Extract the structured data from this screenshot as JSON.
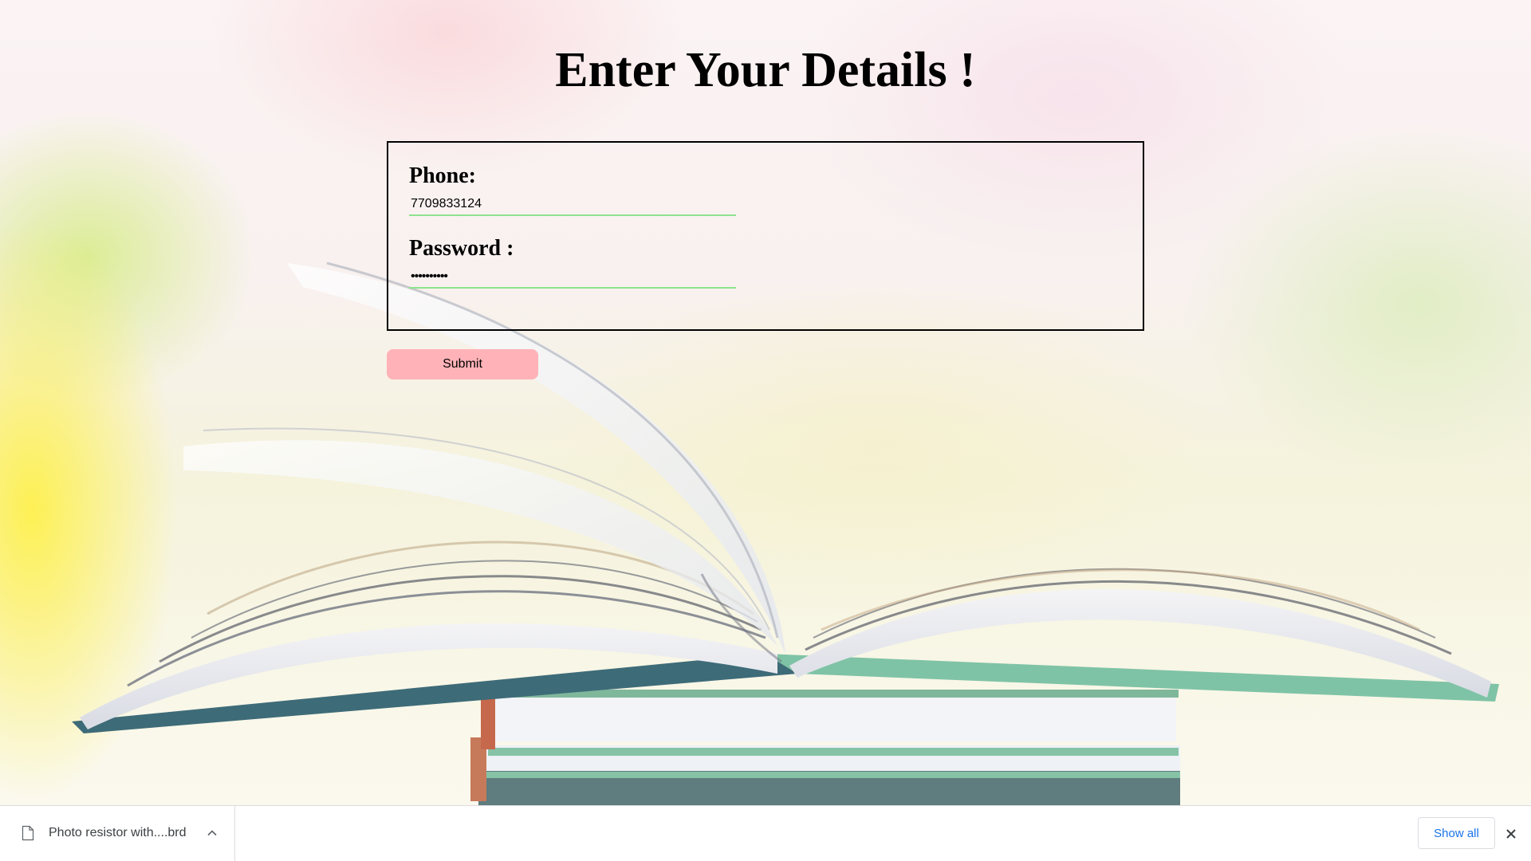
{
  "page": {
    "title": "Enter Your Details !"
  },
  "form": {
    "phone_label": "Phone:",
    "phone_value": "7709833124",
    "password_label": "Password :",
    "password_masked": "••••••••••",
    "submit_label": "Submit",
    "input_underline_color": "#8ee38e",
    "submit_color": "#ffb3b8"
  },
  "download_bar": {
    "file_name": "Photo resistor with....brd",
    "show_all_label": "Show all",
    "file_icon": "file-icon",
    "expand_icon": "chevron-up-icon",
    "close_icon": "close-icon",
    "link_color": "#1a73e8"
  },
  "background": {
    "image": "open-book-on-book-stack"
  }
}
